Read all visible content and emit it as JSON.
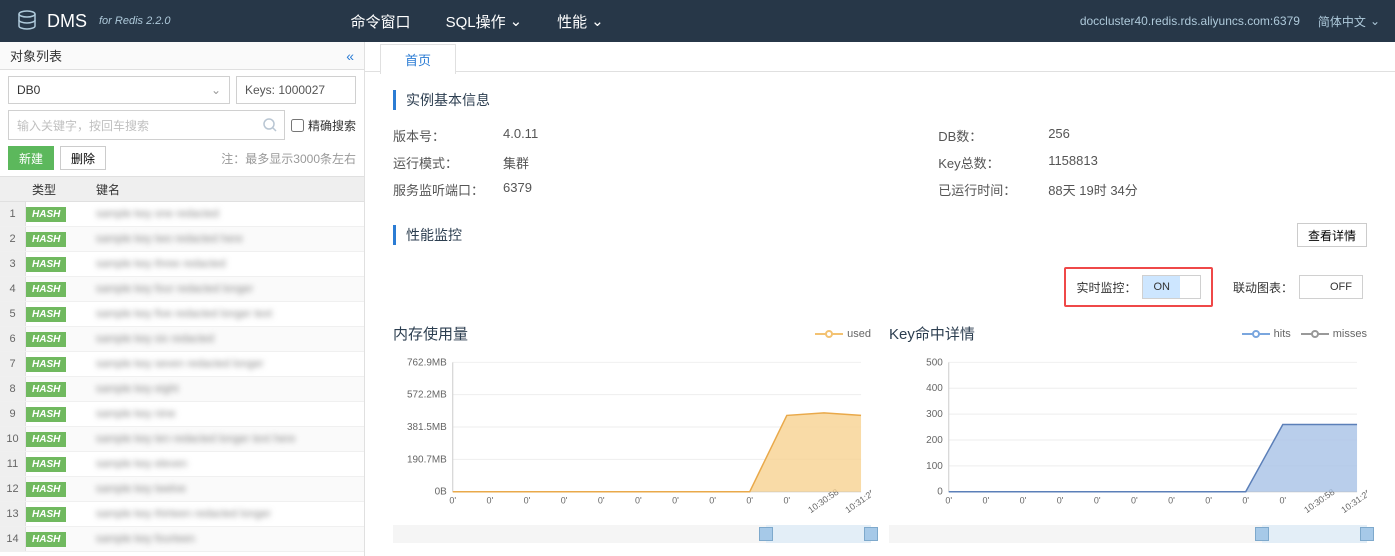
{
  "header": {
    "brand": "DMS",
    "brand_sub": "for Redis 2.2.0",
    "nav": {
      "cmd": "命令窗口",
      "sql": "SQL操作",
      "perf": "性能"
    },
    "connection": "doccluster40.redis.rds.aliyuncs.com:6379",
    "lang": "简体中文"
  },
  "sidebar": {
    "title": "对象列表",
    "db_selected": "DB0",
    "keys_count": "Keys: 1000027",
    "search_placeholder": "输入关键字，按回车搜索",
    "exact_search_label": "精确搜索",
    "btn_new": "新建",
    "btn_delete": "删除",
    "note": "注：最多显示3000条左右",
    "columns": {
      "type": "类型",
      "name": "键名"
    },
    "rows": [
      {
        "idx": 1,
        "type": "HASH",
        "name": "sample key one redacted"
      },
      {
        "idx": 2,
        "type": "HASH",
        "name": "sample key two redacted here"
      },
      {
        "idx": 3,
        "type": "HASH",
        "name": "sample key three redacted"
      },
      {
        "idx": 4,
        "type": "HASH",
        "name": "sample key four redacted longer"
      },
      {
        "idx": 5,
        "type": "HASH",
        "name": "sample key five redacted longer text"
      },
      {
        "idx": 6,
        "type": "HASH",
        "name": "sample key six redacted"
      },
      {
        "idx": 7,
        "type": "HASH",
        "name": "sample key seven redacted longer"
      },
      {
        "idx": 8,
        "type": "HASH",
        "name": "sample key eight"
      },
      {
        "idx": 9,
        "type": "HASH",
        "name": "sample key nine"
      },
      {
        "idx": 10,
        "type": "HASH",
        "name": "sample key ten redacted longer text here"
      },
      {
        "idx": 11,
        "type": "HASH",
        "name": "sample key eleven"
      },
      {
        "idx": 12,
        "type": "HASH",
        "name": "sample key twelve"
      },
      {
        "idx": 13,
        "type": "HASH",
        "name": "sample key thirteen redacted longer"
      },
      {
        "idx": 14,
        "type": "HASH",
        "name": "sample key fourteen"
      }
    ]
  },
  "content": {
    "tab": "首页",
    "section_basic": "实例基本信息",
    "info": {
      "version_label": "版本号：",
      "version_value": "4.0.11",
      "mode_label": "运行模式：",
      "mode_value": "集群",
      "port_label": "服务监听端口：",
      "port_value": "6379",
      "db_label": "DB数：",
      "db_value": "256",
      "keys_label": "Key总数：",
      "keys_value": "1158813",
      "uptime_label": "已运行时间：",
      "uptime_value": "88天 19时 34分"
    },
    "section_perf": "性能监控",
    "btn_detail": "查看详情",
    "realtime_label": "实时监控：",
    "toggle_on": "ON",
    "toggle_off": "OFF",
    "linked_label": "联动图表：",
    "chart1": {
      "title": "内存使用量",
      "legend_used": "used"
    },
    "chart2": {
      "title": "Key命中详情",
      "legend_hits": "hits",
      "legend_misses": "misses"
    }
  },
  "chart_data": [
    {
      "type": "area",
      "title": "内存使用量",
      "series": [
        {
          "name": "used",
          "values": [
            0,
            0,
            0,
            0,
            0,
            0,
            0,
            0,
            0,
            450,
            465,
            450
          ]
        }
      ],
      "x_ticks": [
        "0'",
        "0'",
        "0'",
        "0'",
        "0'",
        "0'",
        "0'",
        "0'",
        "0'",
        "0'",
        "10:30:58",
        "10:31:25"
      ],
      "y_ticks": [
        "0B",
        "190.7MB",
        "381.5MB",
        "572.2MB",
        "762.9MB"
      ],
      "ylim_mb": [
        0,
        762.9
      ],
      "ylabel": "",
      "xlabel": ""
    },
    {
      "type": "area",
      "title": "Key命中详情",
      "series": [
        {
          "name": "hits",
          "values": [
            0,
            0,
            0,
            0,
            0,
            0,
            0,
            0,
            0,
            260,
            260,
            260
          ]
        },
        {
          "name": "misses",
          "values": [
            0,
            0,
            0,
            0,
            0,
            0,
            0,
            0,
            0,
            0,
            0,
            0
          ]
        }
      ],
      "x_ticks": [
        "0'",
        "0'",
        "0'",
        "0'",
        "0'",
        "0'",
        "0'",
        "0'",
        "0'",
        "0'",
        "10:30:58",
        "10:31:25"
      ],
      "y_ticks": [
        "0",
        "100",
        "200",
        "300",
        "400",
        "500"
      ],
      "ylim": [
        0,
        500
      ],
      "ylabel": "",
      "xlabel": ""
    }
  ]
}
